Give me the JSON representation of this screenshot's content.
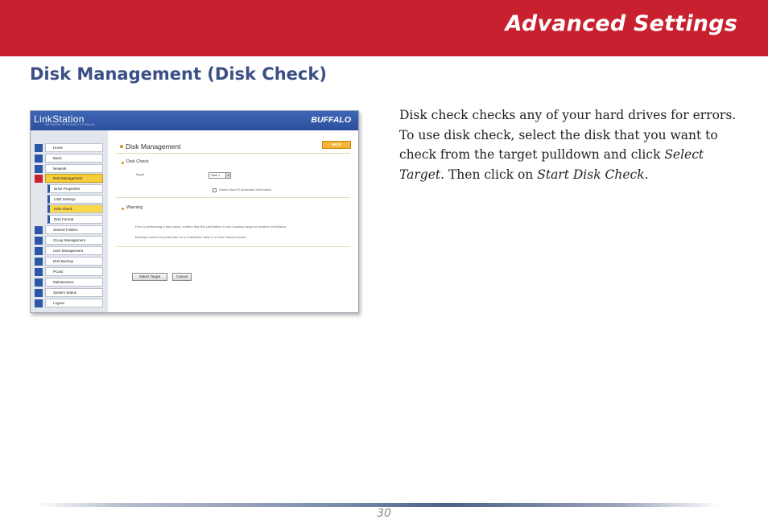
{
  "header": {
    "title": "Advanced Settings"
  },
  "section": {
    "title": "Disk Management (Disk Check)"
  },
  "body": {
    "part1": "Disk check checks any of your hard drives for errors.  To use disk check, select the disk that you want to check from the target pulldown and click ",
    "select_target": "Select Target",
    "part2": ".  Then click on ",
    "start_disk_check": "Start Disk Check",
    "part3": "."
  },
  "screenshot": {
    "logo": "LinkStation",
    "logo_sub": "NETWORK ATTACHED STORAGE",
    "brand": "BUFFALO",
    "nav": [
      {
        "label": "Home",
        "sub": false
      },
      {
        "label": "Basic",
        "sub": false
      },
      {
        "label": "Network",
        "sub": false
      },
      {
        "label": "Disk Management",
        "sub": false,
        "active": true
      },
      {
        "label": "Drive Properties",
        "sub": true
      },
      {
        "label": "USB Settings",
        "sub": true
      },
      {
        "label": "Disk Check",
        "sub": true,
        "selected": true
      },
      {
        "label": "Disk Format",
        "sub": true
      },
      {
        "label": "Shared Folders",
        "sub": false
      },
      {
        "label": "Group Management",
        "sub": false
      },
      {
        "label": "User Management",
        "sub": false
      },
      {
        "label": "Disk Backup",
        "sub": false
      },
      {
        "label": "PCast",
        "sub": false
      },
      {
        "label": "Maintenance",
        "sub": false
      },
      {
        "label": "System Status",
        "sub": false
      },
      {
        "label": "Logout",
        "sub": false
      }
    ],
    "main": {
      "title": "Disk Management",
      "help": "HELP",
      "disk_check_heading": "Disk Check",
      "target_label": "Target",
      "target_value": "Disk 1",
      "checkbox_label": "Delete MacOS dedicated information",
      "warning_heading": "Warning",
      "warning_line1": "Prior to performing a disk check, confirm that this LinkStation is not a backup target of another LinkStation.",
      "warning_line2": "Backups cannot be performed on a LinkStation while in a Disk Check process.",
      "select_target_button": "Select Target",
      "cancel_button": "Cancel"
    }
  },
  "footer": {
    "page_number": "30"
  },
  "colors": {
    "header_red": "#c8202f",
    "section_blue": "#3b4f87",
    "nav_blue": "#2b58a6",
    "highlight_yellow": "#f8cd3a"
  }
}
